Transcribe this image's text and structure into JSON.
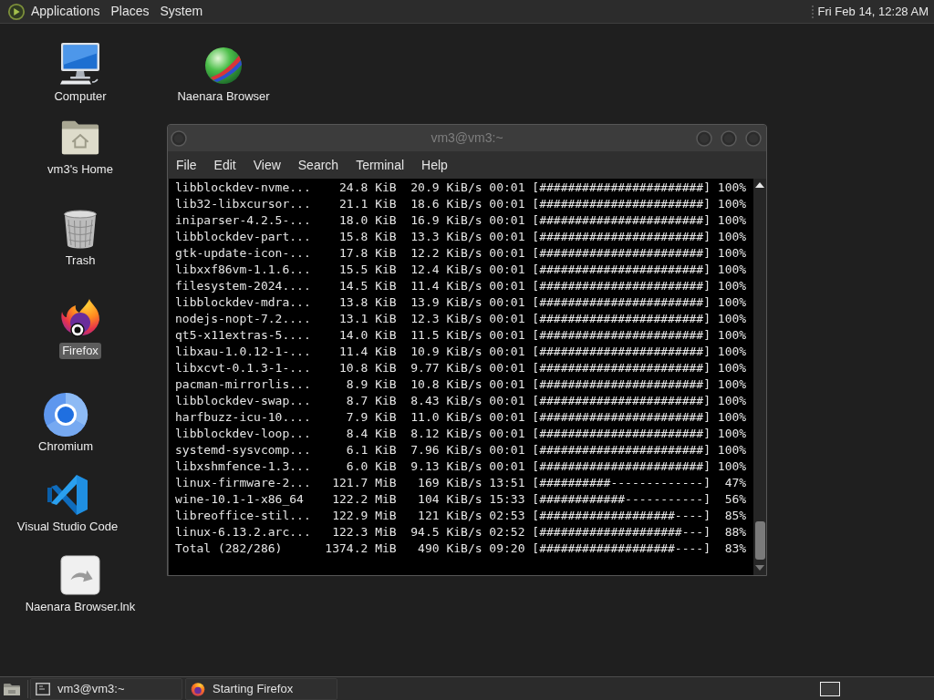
{
  "top_panel": {
    "menus": [
      "Applications",
      "Places",
      "System"
    ],
    "clock": "Fri Feb 14, 12:28 AM"
  },
  "desktop_icons": [
    {
      "label": "Computer",
      "kind": "computer",
      "selected": false
    },
    {
      "label": "Naenara Browser",
      "kind": "globe",
      "selected": false
    },
    {
      "label": "vm3's Home",
      "kind": "home",
      "selected": false
    },
    {
      "label": "Trash",
      "kind": "trash",
      "selected": false
    },
    {
      "label": "Firefox",
      "kind": "firefox",
      "selected": true
    },
    {
      "label": "Chromium",
      "kind": "chromium",
      "selected": false
    },
    {
      "label": "Visual Studio Code",
      "kind": "vscode",
      "selected": false
    },
    {
      "label": "Naenara Browser.lnk",
      "kind": "link",
      "selected": false
    }
  ],
  "terminal_window": {
    "title": "vm3@vm3:~",
    "menus": [
      "File",
      "Edit",
      "View",
      "Search",
      "Terminal",
      "Help"
    ],
    "lines": [
      "libblockdev-nvme...    24.8 KiB  20.9 KiB/s 00:01 [#######################] 100%",
      "lib32-libxcursor...    21.1 KiB  18.6 KiB/s 00:01 [#######################] 100%",
      "iniparser-4.2.5-...    18.0 KiB  16.9 KiB/s 00:01 [#######################] 100%",
      "libblockdev-part...    15.8 KiB  13.3 KiB/s 00:01 [#######################] 100%",
      "gtk-update-icon-...    17.8 KiB  12.2 KiB/s 00:01 [#######################] 100%",
      "libxxf86vm-1.1.6...    15.5 KiB  12.4 KiB/s 00:01 [#######################] 100%",
      "filesystem-2024....    14.5 KiB  11.4 KiB/s 00:01 [#######################] 100%",
      "libblockdev-mdra...    13.8 KiB  13.9 KiB/s 00:01 [#######################] 100%",
      "nodejs-nopt-7.2....    13.1 KiB  12.3 KiB/s 00:01 [#######################] 100%",
      "qt5-x11extras-5....    14.0 KiB  11.5 KiB/s 00:01 [#######################] 100%",
      "libxau-1.0.12-1-...    11.4 KiB  10.9 KiB/s 00:01 [#######################] 100%",
      "libxcvt-0.1.3-1-...    10.8 KiB  9.77 KiB/s 00:01 [#######################] 100%",
      "pacman-mirrorlis...     8.9 KiB  10.8 KiB/s 00:01 [#######################] 100%",
      "libblockdev-swap...     8.7 KiB  8.43 KiB/s 00:01 [#######################] 100%",
      "harfbuzz-icu-10....     7.9 KiB  11.0 KiB/s 00:01 [#######################] 100%",
      "libblockdev-loop...     8.4 KiB  8.12 KiB/s 00:01 [#######################] 100%",
      "systemd-sysvcomp...     6.1 KiB  7.96 KiB/s 00:01 [#######################] 100%",
      "libxshmfence-1.3...     6.0 KiB  9.13 KiB/s 00:01 [#######################] 100%",
      "linux-firmware-2...   121.7 MiB   169 KiB/s 13:51 [##########-------------]  47%",
      "wine-10.1-1-x86_64    122.2 MiB   104 KiB/s 15:33 [############-----------]  56%",
      "libreoffice-stil...   122.9 MiB   121 KiB/s 02:53 [###################----]  85%",
      "linux-6.13.2.arc...   122.3 MiB  94.5 KiB/s 02:52 [####################---]  88%",
      "Total (282/286)      1374.2 MiB   490 KiB/s 09:20 [###################----]  83%"
    ]
  },
  "taskbar": {
    "tasks": [
      {
        "label": "vm3@vm3:~",
        "kind": "terminal"
      },
      {
        "label": "Starting Firefox",
        "kind": "firefox"
      }
    ]
  }
}
